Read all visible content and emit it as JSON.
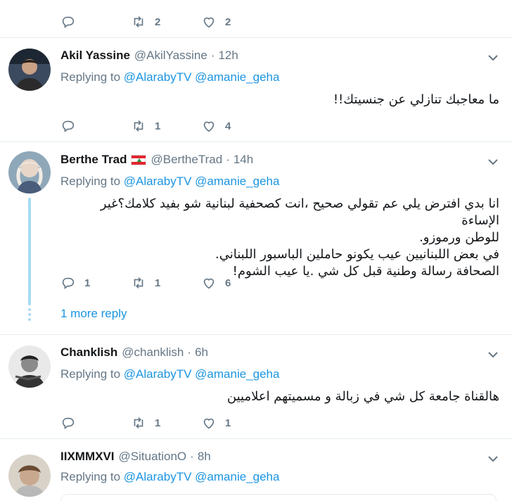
{
  "top_stats": {
    "reply_count": "",
    "retweet_count": "2",
    "like_count": "2"
  },
  "tweets": [
    {
      "name": "Akil Yassine",
      "handle": "@AkilYassine",
      "time": "12h",
      "replying_prefix": "Replying to",
      "mention_1": "@AlarabyTV",
      "mention_2": "@amanie_geha",
      "lines": [
        "ما معاجبك تنازلي عن جنسيتك!!"
      ],
      "reply_count": "",
      "retweet_count": "1",
      "like_count": "4"
    },
    {
      "name": "Berthe Trad",
      "handle": "@BertheTrad",
      "time": "14h",
      "replying_prefix": "Replying to",
      "mention_1": "@AlarabyTV",
      "mention_2": "@amanie_geha",
      "lines": [
        "انا بدي افترض يلي عم تقولي صحيح ،انت كصحفية لبنانية شو بفيد كلامك؟غير الإساءة",
        "للوطن ورموزو.",
        "في بعض اللبنانيين عيب يكونو حاملين الباسبور اللبناني.",
        "الصحافة رسالة وطنية قبل كل شي .يا عيب الشوم!"
      ],
      "reply_count": "1",
      "retweet_count": "1",
      "like_count": "6",
      "more_reply": "1 more reply"
    },
    {
      "name": "Chanklish",
      "handle": "@chanklish",
      "time": "6h",
      "replying_prefix": "Replying to",
      "mention_1": "@AlarabyTV",
      "mention_2": "@amanie_geha",
      "lines": [
        "هالقناة جامعة كل شي في زبالة و مسميتهم اعلاميين"
      ],
      "reply_count": "",
      "retweet_count": "1",
      "like_count": "1"
    },
    {
      "name": "IIXMMXVI",
      "handle": "@SituationO",
      "time": "8h",
      "replying_prefix": "Replying to",
      "mention_1": "@AlarabyTV",
      "mention_2": "@amanie_geha"
    }
  ],
  "separator_dot": "·",
  "colors": {
    "link": "#1b95e0",
    "muted": "#657786",
    "thread": "#a9daf5",
    "border": "#e6ecf0"
  },
  "icons": [
    "reply-icon",
    "retweet-icon",
    "like-icon",
    "chevron-down-icon",
    "lebanon-flag-icon"
  ]
}
